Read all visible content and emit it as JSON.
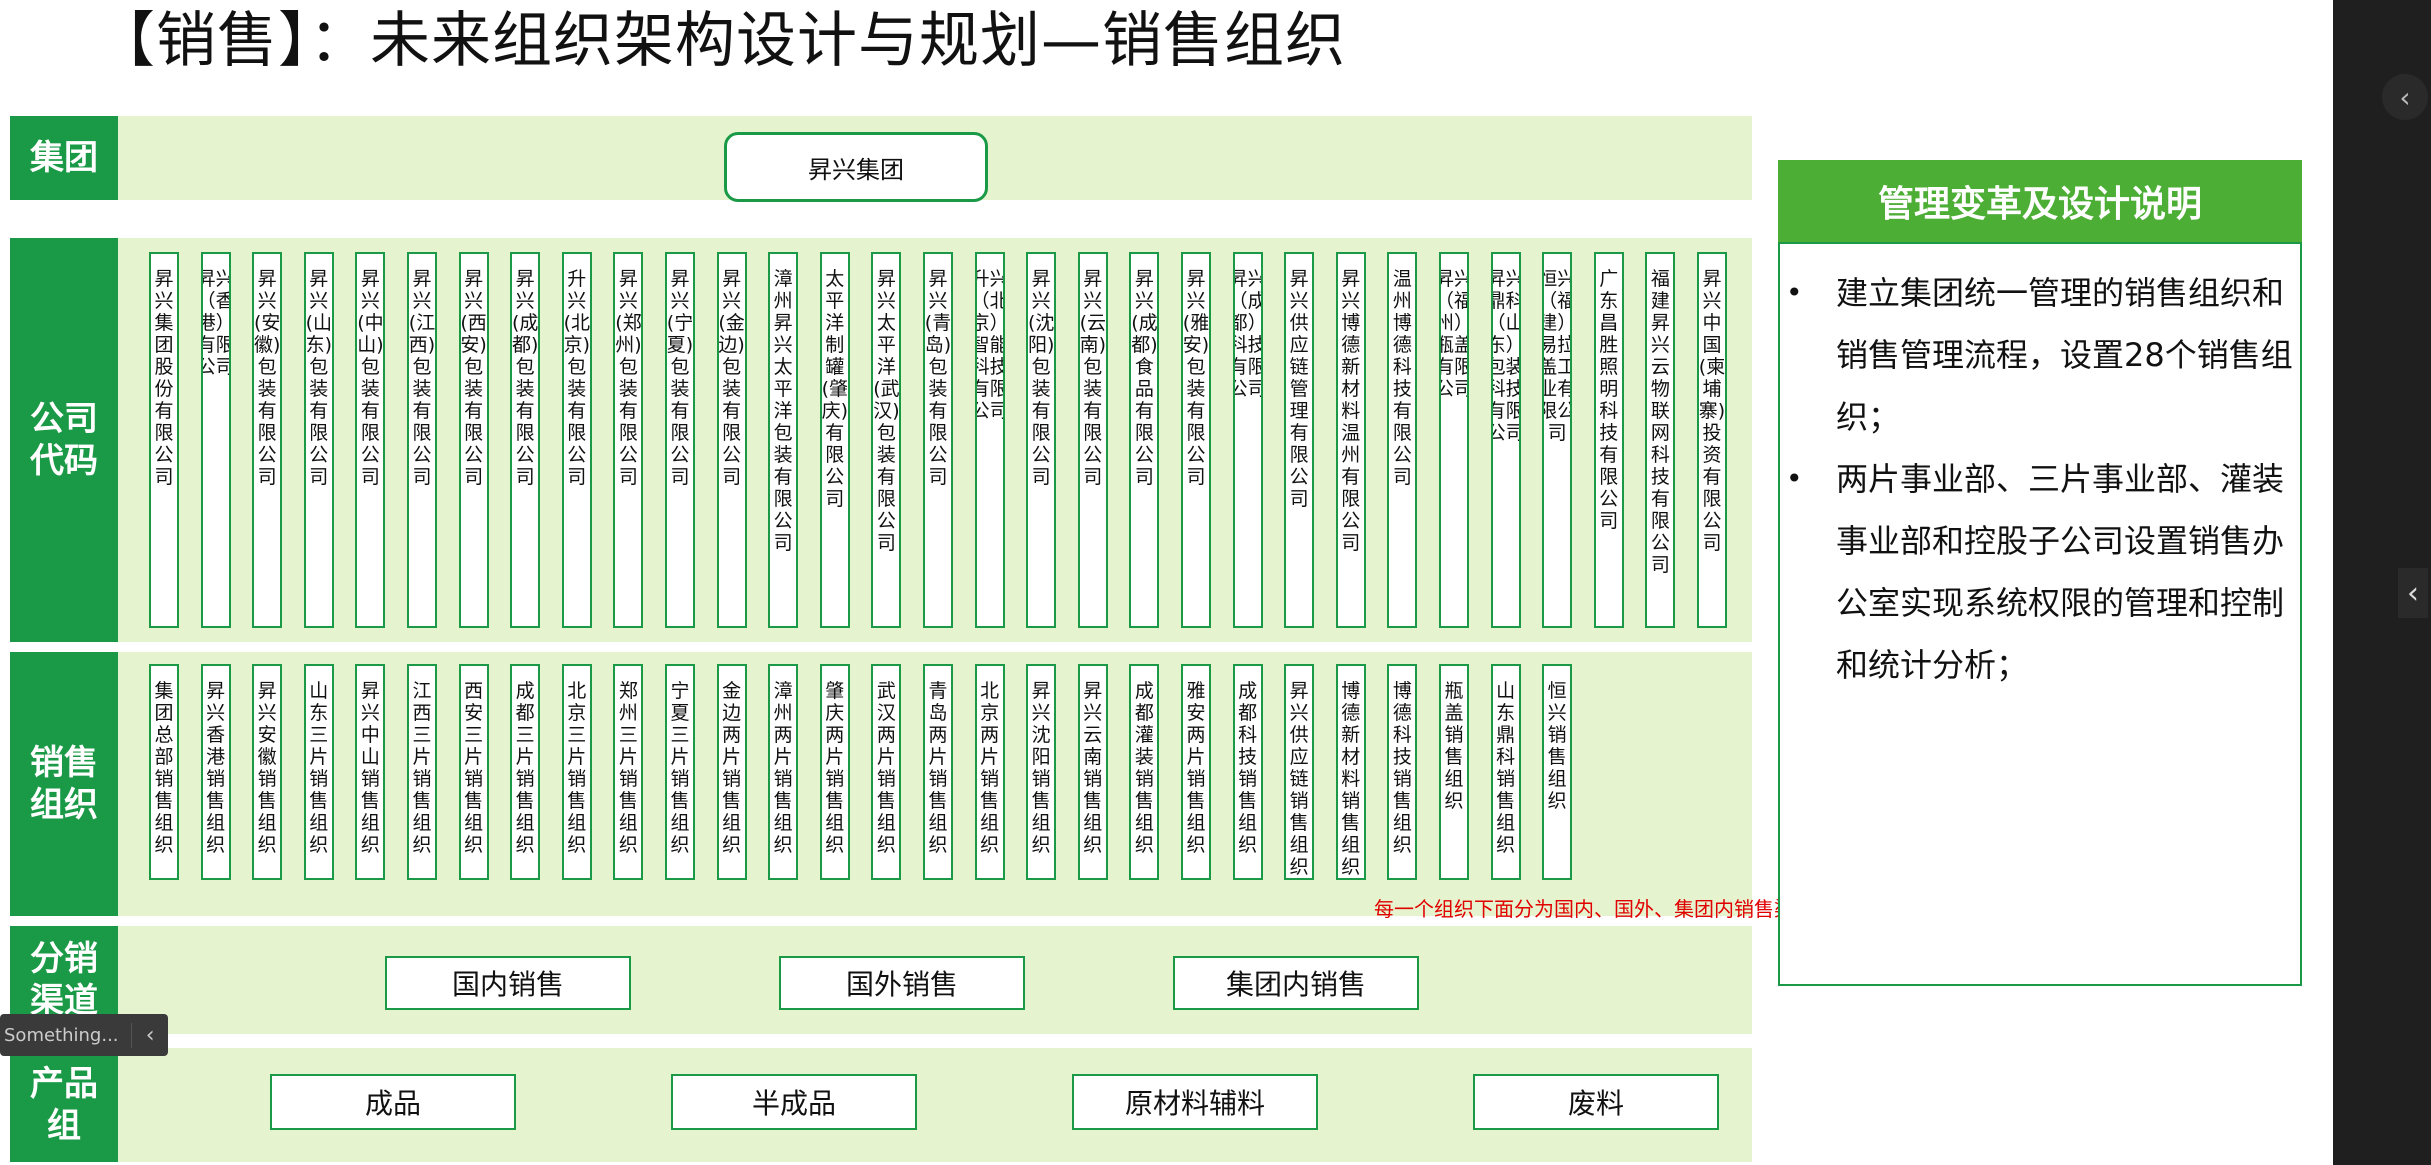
{
  "title": "【销售】：未来组织架构设计与规划—销售组织",
  "rows": {
    "group": "集团",
    "company": "公司代码",
    "sales": "销售组织",
    "channel": "分销渠道",
    "product": "产品组"
  },
  "group_name": "昇兴集团",
  "companies": [
    "昇兴集团股份有限公司",
    "昇兴（香港）有限公司",
    "昇兴(安徽)包装有限公司",
    "昇兴(山东)包装有限公司",
    "昇兴(中山)包装有限公司",
    "昇兴(江西)包装有限公司",
    "昇兴(西安)包装有限公司",
    "昇兴(成都)包装有限公司",
    "升兴(北京)包装有限公司",
    "昇兴(郑州)包装有限公司",
    "昇兴(宁夏)包装有限公司",
    "昇兴(金边)包装有限公司",
    "漳州昇兴太平洋包装有限公司",
    "太平洋制罐(肇庆)有限公司",
    "昇兴太平洋(武汉)包装有限公司",
    "昇兴(青岛)包装有限公司",
    "升兴（北京）智能科技有限公司",
    "昇兴(沈阳)包装有限公司",
    "昇兴(云南)包装有限公司",
    "昇兴(成都)食品有限公司",
    "昇兴(雅安)包装有限公司",
    "昇兴（成都）科技有限公司",
    "昇兴供应链管理有限公司",
    "昇兴博德新材料温州有限公司",
    "温州博德科技有限公司",
    "昇兴（福州）瓶盖有限公司",
    "昇兴鼎科（山东）包装科技有限公司",
    "恒兴（福建）易拉盖工业有限公司",
    "广东昌胜照明科技有限公司",
    "福建昇兴云物联网科技有限公司",
    "昇兴中国(柬埔寨)投资有限公司"
  ],
  "sales_orgs": [
    "集团总部销售组织",
    "昇兴香港销售组织",
    "昇兴安徽销售组织",
    "山东三片销售组织",
    "昇兴中山销售组织",
    "江西三片销售组织",
    "西安三片销售组织",
    "成都三片销售组织",
    "北京三片销售组织",
    "郑州三片销售组织",
    "宁夏三片销售组织",
    "金边两片销售组织",
    "漳州两片销售组织",
    "肇庆两片销售组织",
    "武汉两片销售组织",
    "青岛两片销售组织",
    "北京两片销售组织",
    "昇兴沈阳销售组织",
    "昇兴云南销售组织",
    "成都灌装销售组织",
    "雅安两片销售组织",
    "成都科技销售组织",
    "昇兴供应链销售组织",
    "博德新材料销售组织",
    "博德科技销售组织",
    "瓶盖销售组织",
    "山东鼎科销售组织",
    "恒兴销售组织"
  ],
  "channels": [
    "国内销售",
    "国外销售",
    "集团内销售"
  ],
  "products": [
    "成品",
    "半成品",
    "原材料辅料",
    "废料"
  ],
  "note": "每一个组织下面分为国内、国外、集团内销售渠道(用线关联一下 举例说明) 销售说明 描述去掉",
  "management": {
    "heading": "管理变革及设计说明",
    "bullets": [
      "建立集团统一管理的销售组织和销售管理流程，设置28个销售组织；",
      "两片事业部、三片事业部、灌装事业部和控股子公司设置销售办公室实现系统权限的管理和控制和统计分析；"
    ]
  },
  "overlay_text": "Something...",
  "colors": {
    "green": "#1a9a46",
    "band": "#e6f3cf",
    "header": "#4cae34",
    "note": "#e00000"
  }
}
